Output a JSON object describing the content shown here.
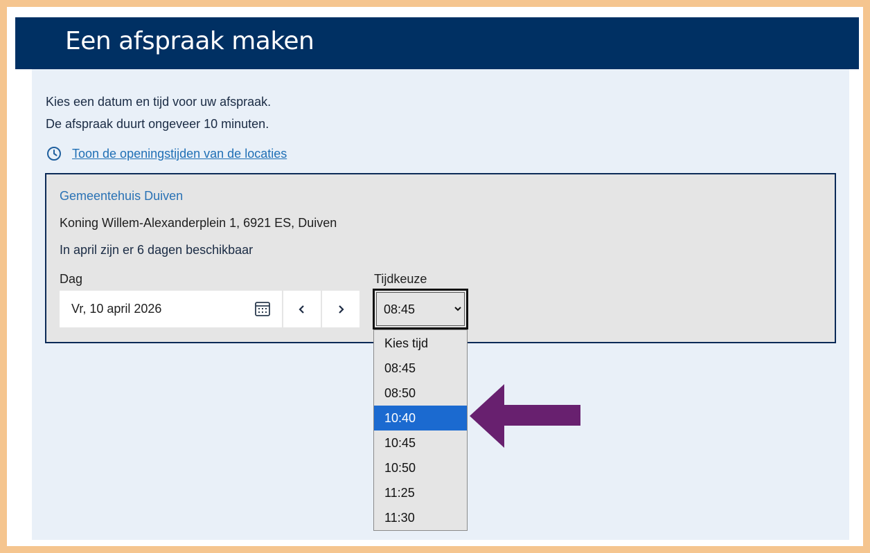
{
  "header": {
    "title": "Een afspraak maken"
  },
  "intro": {
    "line1": "Kies een datum en tijd voor uw afspraak.",
    "line2": "De afspraak duurt ongeveer 10 minuten."
  },
  "hours_link": {
    "label": "Toon de openingstijden van de locaties",
    "icon": "clock-icon"
  },
  "location": {
    "name": "Gemeentehuis Duiven",
    "address": "Koning Willem-Alexanderplein 1, 6921 ES, Duiven",
    "availability": "In april zijn er 6 dagen beschikbaar"
  },
  "day": {
    "label": "Dag",
    "value": "Vr, 10 april 2026",
    "prev_label": "‹",
    "next_label": "›"
  },
  "time": {
    "label": "Tijdkeuze",
    "selected": "08:45",
    "options": [
      "Kies tijd",
      "08:45",
      "08:50",
      "10:40",
      "10:45",
      "10:50",
      "11:25",
      "11:30"
    ],
    "highlighted": "10:40"
  },
  "colors": {
    "header_bg": "#003063",
    "frame_border": "#f5c58f",
    "highlight": "#1b6ad0",
    "annotation_arrow": "#68206f"
  }
}
